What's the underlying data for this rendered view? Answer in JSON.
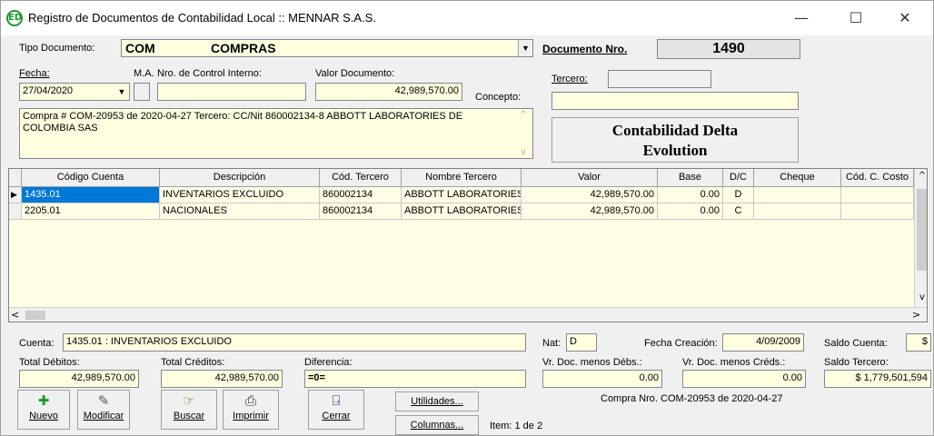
{
  "window": {
    "title": "Registro de Documentos de Contabilidad Local :: MENNAR S.A.S.",
    "logo_text": "ED",
    "controls": [
      "—",
      "☐",
      "✕"
    ]
  },
  "header": {
    "tipo_label": "Tipo Documento:",
    "tipo_code": "COM",
    "tipo_name": "COMPRAS",
    "docnro_label": "Documento Nro.",
    "docnro_value": "1490",
    "fecha_label": "Fecha:",
    "fecha_value": "27/04/2020",
    "ma_label": "M.A.",
    "control_label": "Nro. de Control Interno:",
    "control_value": "",
    "valor_label": "Valor Documento:",
    "valor_value": "42,989,570.00",
    "concepto_label": "Concepto:",
    "concepto_text": "Compra # COM-20953 de 2020-04-27 Tercero: CC/Nit 860002134-8 ABBOTT LABORATORIES DE COLOMBIA SAS",
    "tercero_label": "Tercero:",
    "tercero_value": "",
    "tercero_name": "",
    "brand_line1": "Contabilidad Delta",
    "brand_line2": "Evolution"
  },
  "grid": {
    "columns": [
      "Código Cuenta",
      "Descripción",
      "Cód. Tercero",
      "Nombre Tercero",
      "Valor",
      "Base",
      "D/C",
      "Cheque",
      "Cód. C. Costo"
    ],
    "rows": [
      {
        "cuenta": "1435.01",
        "descripcion": "INVENTARIOS EXCLUIDO",
        "cod_tercero": "860002134",
        "nombre_tercero": "ABBOTT LABORATORIES [",
        "valor": "42,989,570.00",
        "base": "0.00",
        "dc": "D",
        "cheque": "",
        "costo": ""
      },
      {
        "cuenta": "2205.01",
        "descripcion": "NACIONALES",
        "cod_tercero": "860002134",
        "nombre_tercero": "ABBOTT LABORATORIES [",
        "valor": "42,989,570.00",
        "base": "0.00",
        "dc": "C",
        "cheque": "",
        "costo": ""
      }
    ]
  },
  "footer": {
    "cuenta_label": "Cuenta:",
    "cuenta_value": "1435.01 : INVENTARIOS EXCLUIDO",
    "nat_label": "Nat:",
    "nat_value": "D",
    "fecha_creacion_label": "Fecha Creación:",
    "fecha_creacion_value": "4/09/2009",
    "saldo_cuenta_label": "Saldo Cuenta:",
    "saldo_cuenta_value": "$",
    "total_debitos_label": "Total Débitos:",
    "total_debitos_value": "42,989,570.00",
    "total_creditos_label": "Total Créditos:",
    "total_creditos_value": "42,989,570.00",
    "diferencia_label": "Diferencia:",
    "diferencia_value": "=0=",
    "vr_debs_label": "Vr. Doc. menos Débs.:",
    "vr_debs_value": "0.00",
    "vr_creds_label": "Vr. Doc. menos Créds.:",
    "vr_creds_value": "0.00",
    "saldo_tercero_label": "Saldo Tercero:",
    "saldo_tercero_value": "$ 1,779,501,594"
  },
  "toolbar": {
    "nuevo": "Nuevo",
    "modificar": "Modificar",
    "buscar": "Buscar",
    "imprimir": "Imprimir",
    "cerrar": "Cerrar",
    "utilidades": "Utilidades...",
    "columnas": "Columnas...",
    "item_text": "Item: 1 de 2",
    "compra_text": "Compra Nro. COM-20953 de 2020-04-27"
  },
  "icons": {
    "nuevo": "plus-icon",
    "modificar": "edit-icon",
    "buscar": "search-icon",
    "imprimir": "printer-icon",
    "cerrar": "exit-icon"
  },
  "colors": {
    "field_bg": "#ffffe0",
    "selection": "#0078d7",
    "brand_green": "#1a9a2a"
  }
}
